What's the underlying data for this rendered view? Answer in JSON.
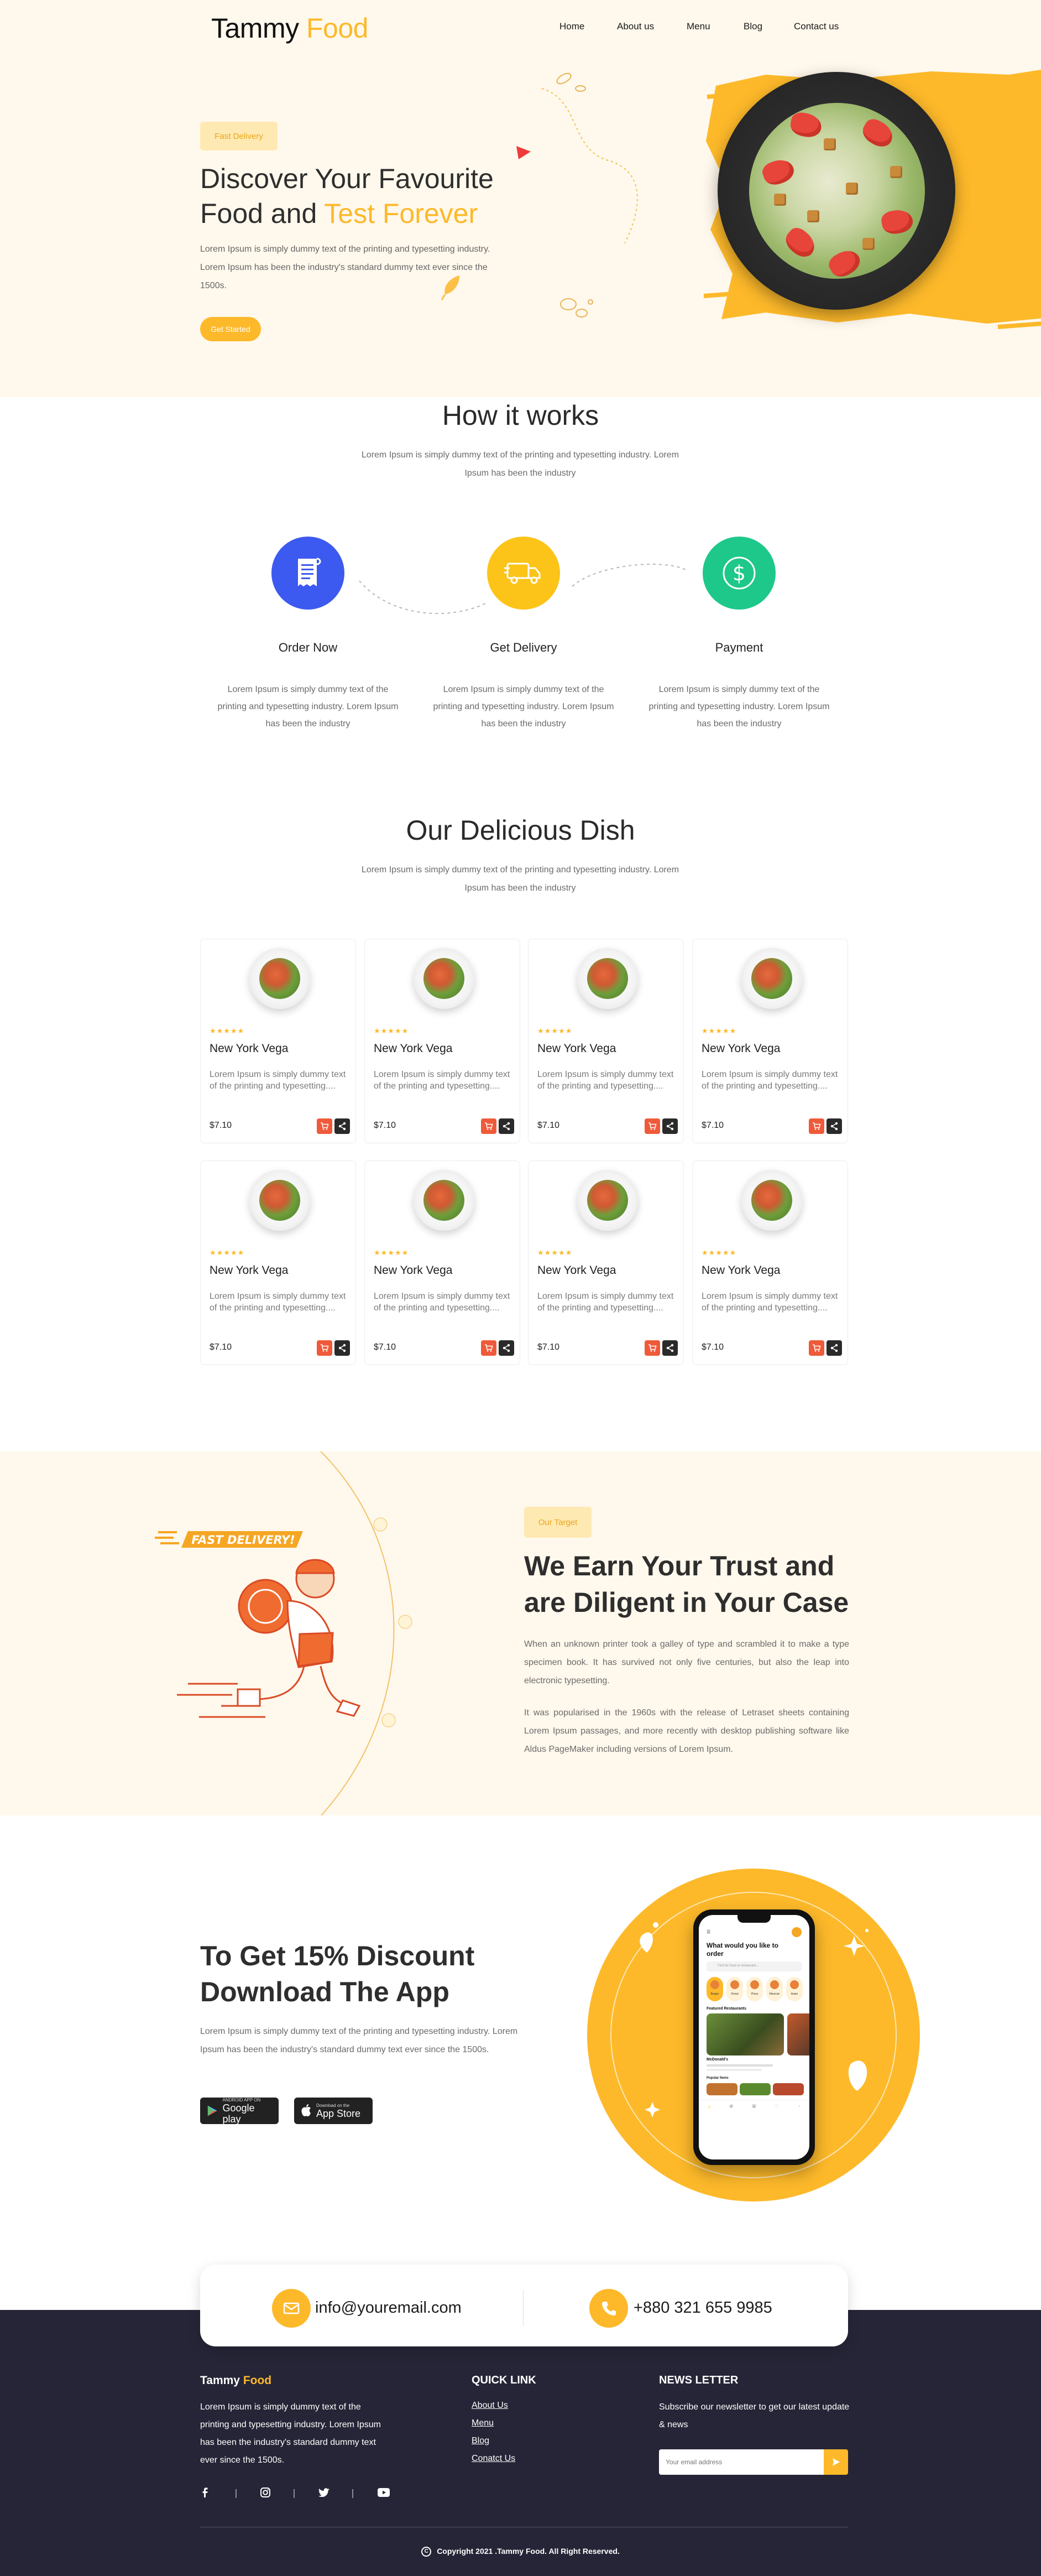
{
  "header": {
    "logo_main": "Tammy",
    "logo_accent": "Food",
    "nav": [
      "Home",
      "About us",
      "Menu",
      "Blog",
      "Contact us"
    ]
  },
  "hero": {
    "badge": "Fast Delivery",
    "title_line1": "Discover Your Favourite",
    "title_line2_plain": "Food and",
    "title_line2_accent": "Test Forever",
    "text": "Lorem Ipsum is simply dummy text of the printing and typesetting industry. Lorem Ipsum has been the industry's standard dummy text ever since the 1500s.",
    "button": "Get Started"
  },
  "how": {
    "title": "How it works",
    "subtitle": "Lorem Ipsum is simply dummy text of the printing and typesetting industry. Lorem Ipsum has been the industry",
    "steps": [
      {
        "title": "Order Now",
        "text": "Lorem Ipsum is simply dummy text of the printing and typesetting industry. Lorem Ipsum has been the industry",
        "color": "#3c59f0",
        "icon": "receipt-icon"
      },
      {
        "title": "Get Delivery",
        "text": "Lorem Ipsum is simply dummy text of the printing and typesetting industry. Lorem Ipsum has been the industry",
        "color": "#fcc419",
        "icon": "delivery-truck-icon"
      },
      {
        "title": "Payment",
        "text": "Lorem Ipsum is simply dummy text of the printing and typesetting industry. Lorem Ipsum has been the industry",
        "color": "#1ec88b",
        "icon": "dollar-icon"
      }
    ]
  },
  "dishes": {
    "title": "Our Delicious Dish",
    "subtitle": "Lorem Ipsum is simply dummy text of the printing and typesetting industry. Lorem Ipsum has been the industry",
    "items": [
      {
        "name": "New York Vega",
        "stars": "★★★★★",
        "desc": "Lorem Ipsum is simply dummy text of the printing and typesetting....",
        "price": "$7.10"
      },
      {
        "name": "New York Vega",
        "stars": "★★★★★",
        "desc": "Lorem Ipsum is simply dummy text of the printing and typesetting....",
        "price": "$7.10"
      },
      {
        "name": "New York Vega",
        "stars": "★★★★★",
        "desc": "Lorem Ipsum is simply dummy text of the printing and typesetting....",
        "price": "$7.10"
      },
      {
        "name": "New York Vega",
        "stars": "★★★★★",
        "desc": "Lorem Ipsum is simply dummy text of the printing and typesetting....",
        "price": "$7.10"
      },
      {
        "name": "New York Vega",
        "stars": "★★★★★",
        "desc": "Lorem Ipsum is simply dummy text of the printing and typesetting....",
        "price": "$7.10"
      },
      {
        "name": "New York Vega",
        "stars": "★★★★★",
        "desc": "Lorem Ipsum is simply dummy text of the printing and typesetting....",
        "price": "$7.10"
      },
      {
        "name": "New York Vega",
        "stars": "★★★★★",
        "desc": "Lorem Ipsum is simply dummy text of the printing and typesetting....",
        "price": "$7.10"
      },
      {
        "name": "New York Vega",
        "stars": "★★★★★",
        "desc": "Lorem Ipsum is simply dummy text of the printing and typesetting....",
        "price": "$7.10"
      }
    ]
  },
  "trust": {
    "badge": "Our Target",
    "illustration_label": "FAST DELIVERY!",
    "title": "We Earn Your Trust and are Diligent in Your Case",
    "p1": "When an unknown printer took a galley of type and scrambled it to make a type specimen book. It has survived not only five centuries, but also the leap into electronic typesetting.",
    "p2": "It was popularised in the 1960s with the release of Letraset sheets containing Lorem Ipsum passages, and more recently with desktop publishing software like Aldus PageMaker including versions of Lorem Ipsum."
  },
  "app": {
    "title": "To Get 15% Discount Download The App",
    "text": "Lorem Ipsum is simply dummy text of the printing and typesetting industry. Lorem Ipsum has been the industry's standard dummy text ever since the 1500s.",
    "google_small": "ANDROID APP ON",
    "google_big": "Google play",
    "apple_small": "Download on the",
    "apple_big": "App Store",
    "phone_heading": "What would you like to order",
    "phone_search": "Find for food or restaurant...",
    "phone_categories": [
      "Burger",
      "Donut",
      "Pizza",
      "Mexican",
      "Asian"
    ],
    "phone_section1": "Featured Restaurants",
    "phone_restaurant": "McDonald's",
    "phone_section2": "Popular Items"
  },
  "contact": {
    "email": "info@youremail.com",
    "phone": "+880 321 655 9985"
  },
  "footer": {
    "logo_main": "Tammy",
    "logo_accent": "Food",
    "about": "Lorem Ipsum is simply dummy text of the printing and typesetting industry. Lorem Ipsum has been the industry's standard dummy text ever since the 1500s.",
    "quick_title": "QUICK LINK",
    "quick_links": [
      "About Us",
      "Menu",
      "Blog",
      "Conatct Us"
    ],
    "news_title": "NEWS LETTER",
    "news_text": "Subscribe our newsletter to get our latest update & news",
    "news_placeholder": "Your email address",
    "copyright": "Copyright 2021 .Tammy Food. All Right Reserved."
  },
  "colors": {
    "accent": "#fdb92a",
    "cart": "#ef5a3a",
    "footer": "#262537"
  }
}
